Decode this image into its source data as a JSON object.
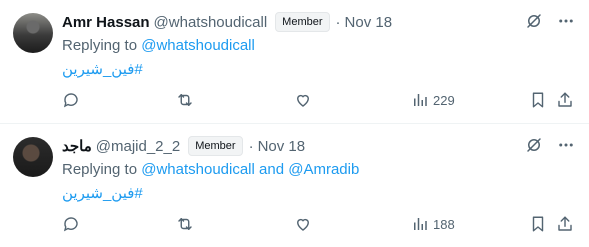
{
  "tweets": [
    {
      "display_name": "Amr Hassan",
      "handle": "@whatshoudicall",
      "badge": "Member",
      "separator": "·",
      "date": "Nov 18",
      "replying_prefix": "Replying to ",
      "replying_to": [
        "@whatshoudicall"
      ],
      "hashtag": "#فين_شيرين",
      "views": "229"
    },
    {
      "display_name": "ماجد",
      "handle": "@majid_2_2",
      "badge": "Member",
      "separator": "·",
      "date": "Nov 18",
      "replying_prefix": "Replying to ",
      "replying_to": [
        "@whatshoudicall",
        "@Amradib"
      ],
      "replying_joiner": " and ",
      "hashtag": "#فين_شيرين",
      "views": "188"
    }
  ],
  "colors": {
    "link": "#1d9bf0",
    "muted": "#536471",
    "text": "#0f1419",
    "divider": "#eff3f4"
  },
  "icons": [
    "grok-icon",
    "more-icon",
    "reply-icon",
    "retweet-icon",
    "like-icon",
    "views-icon",
    "bookmark-icon",
    "share-icon"
  ]
}
